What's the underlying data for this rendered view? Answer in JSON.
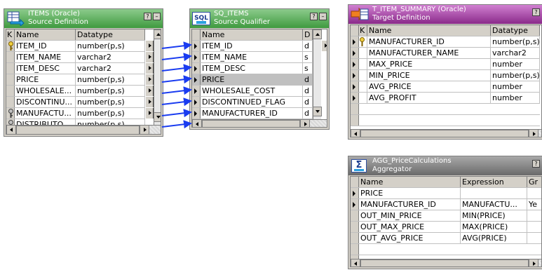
{
  "colors": {
    "link": "#1a3cf0",
    "source_title": "#3f9a3f",
    "target_title": "#8a2a8a",
    "aggregator_title": "#6a6a6a"
  },
  "source": {
    "title": "ITEMS (Oracle)",
    "subtitle": "Source Definition",
    "headers": {
      "key": "K",
      "name": "Name",
      "datatype": "Datatype"
    },
    "rows": [
      {
        "name": "ITEM_ID",
        "datatype": "number(p,s)"
      },
      {
        "name": "ITEM_NAME",
        "datatype": "varchar2"
      },
      {
        "name": "ITEM_DESC",
        "datatype": "varchar2"
      },
      {
        "name": "PRICE",
        "datatype": "number(p,s)"
      },
      {
        "name": "WHOLESALE...",
        "datatype": "number(p,s)"
      },
      {
        "name": "DISCONTINU...",
        "datatype": "number(p,s)"
      },
      {
        "name": "MANUFACTU...",
        "datatype": "number(p,s)"
      },
      {
        "name": "DISTRIBUTO...",
        "datatype": "number(p,s)"
      }
    ]
  },
  "qualifier": {
    "title": "SQ_ITEMS",
    "subtitle": "Source Qualifier",
    "icon_label": "SQL",
    "headers": {
      "name": "Name",
      "datatype": "D"
    },
    "rows": [
      {
        "name": "ITEM_ID",
        "datatype": "d"
      },
      {
        "name": "ITEM_NAME",
        "datatype": "s"
      },
      {
        "name": "ITEM_DESC",
        "datatype": "s"
      },
      {
        "name": "PRICE",
        "datatype": "d"
      },
      {
        "name": "WHOLESALE_COST",
        "datatype": "d"
      },
      {
        "name": "DISCONTINUED_FLAG",
        "datatype": "d"
      },
      {
        "name": "MANUFACTURER_ID",
        "datatype": "d"
      }
    ]
  },
  "target": {
    "title": "T_ITEM_SUMMARY (Oracle)",
    "subtitle": "Target Definition",
    "headers": {
      "key": "K",
      "name": "Name",
      "datatype": "Datatype"
    },
    "rows": [
      {
        "name": "MANUFACTURER_ID",
        "datatype": "number(p,s)"
      },
      {
        "name": "MANUFACTURER_NAME",
        "datatype": "varchar2"
      },
      {
        "name": "MAX_PRICE",
        "datatype": "number"
      },
      {
        "name": "MIN_PRICE",
        "datatype": "number(p,s)"
      },
      {
        "name": "AVG_PRICE",
        "datatype": "number"
      },
      {
        "name": "AVG_PROFIT",
        "datatype": "number"
      }
    ]
  },
  "aggregator": {
    "title": "AGG_PriceCalculations",
    "subtitle": "Aggregator",
    "icon_label": "Σ",
    "headers": {
      "name": "Name",
      "expression": "Expression",
      "groupby": "Gr"
    },
    "rows": [
      {
        "name": "PRICE",
        "expression": "",
        "groupby": ""
      },
      {
        "name": "MANUFACTURER_ID",
        "expression": "MANUFACTU...",
        "groupby": "Ye"
      },
      {
        "name": "OUT_MIN_PRICE",
        "expression": "MIN(PRICE)",
        "groupby": ""
      },
      {
        "name": "OUT_MAX_PRICE",
        "expression": "MAX(PRICE)",
        "groupby": ""
      },
      {
        "name": "OUT_AVG_PRICE",
        "expression": "AVG(PRICE)",
        "groupby": ""
      }
    ]
  }
}
